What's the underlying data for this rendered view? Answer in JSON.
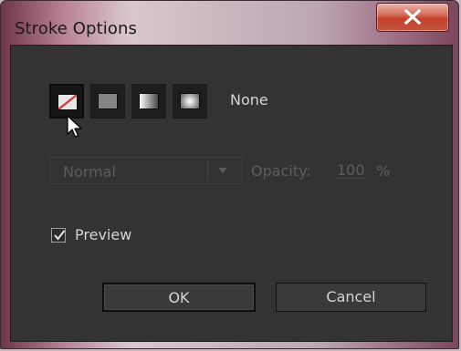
{
  "window": {
    "title": "Stroke Options"
  },
  "fill_types": {
    "items": [
      {
        "name": "none",
        "selected": true
      },
      {
        "name": "solid",
        "selected": false
      },
      {
        "name": "linear-gradient",
        "selected": false
      },
      {
        "name": "radial-gradient",
        "selected": false
      }
    ],
    "current_label": "None"
  },
  "blend_mode": {
    "value": "Normal",
    "enabled": false
  },
  "opacity": {
    "label": "Opacity:",
    "value": "100",
    "unit": "%",
    "enabled": false
  },
  "preview": {
    "label": "Preview",
    "checked": true
  },
  "buttons": {
    "ok": "OK",
    "cancel": "Cancel"
  },
  "colors": {
    "dialog_bg": "#333333",
    "text": "#d4d4d4",
    "disabled_text": "#5c5c5c",
    "close_red": "#c3402b",
    "none_slash": "#e0303a"
  }
}
